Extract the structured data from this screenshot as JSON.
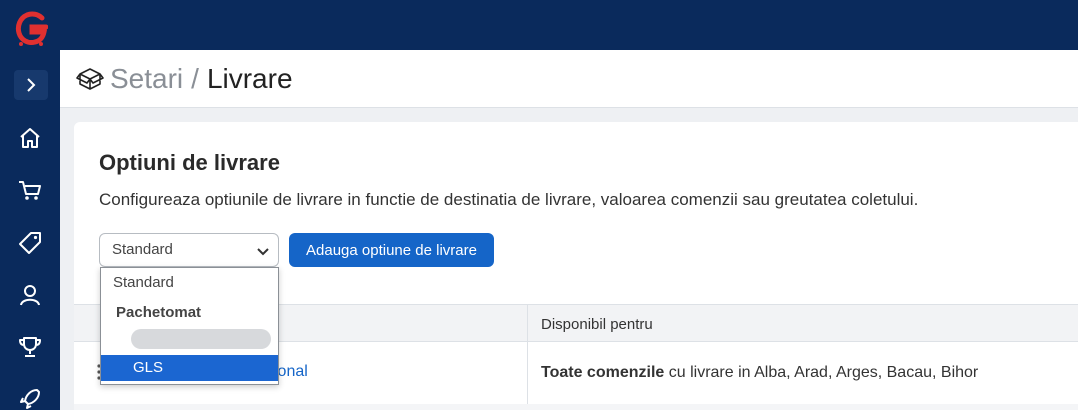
{
  "app": {
    "logo_letter": "G"
  },
  "header": {
    "breadcrumb_parent": "Setari",
    "breadcrumb_separator": "/",
    "breadcrumb_current": "Livrare"
  },
  "card": {
    "title": "Optiuni de livrare",
    "description": "Configureaza optiunile de livrare in functie de destinatia de livrare, valoarea comenzii sau greutatea coletului.",
    "select_value": "Standard",
    "add_button": "Adauga optiune de livrare"
  },
  "dropdown": {
    "options": [
      "Standard",
      "Pachetomat",
      "GLS"
    ],
    "selected": "GLS"
  },
  "table": {
    "col_available": "Disponibil pentru",
    "row_name_partial": "ional",
    "row_avail_bold": "Toate comenzile",
    "row_avail_rest": " cu livrare in Alba, Arad, Arges, Bacau, Bihor"
  },
  "icons": [
    "logo-icon",
    "chevron-right-icon",
    "home-icon",
    "cart-icon",
    "tag-icon",
    "users-icon",
    "trophy-icon",
    "rocket-icon",
    "box-icon",
    "chevron-down-icon",
    "drag-icon"
  ],
  "colors": {
    "navy": "#0a2a5c",
    "accent": "#1565c8",
    "selected": "#1b66d1"
  }
}
